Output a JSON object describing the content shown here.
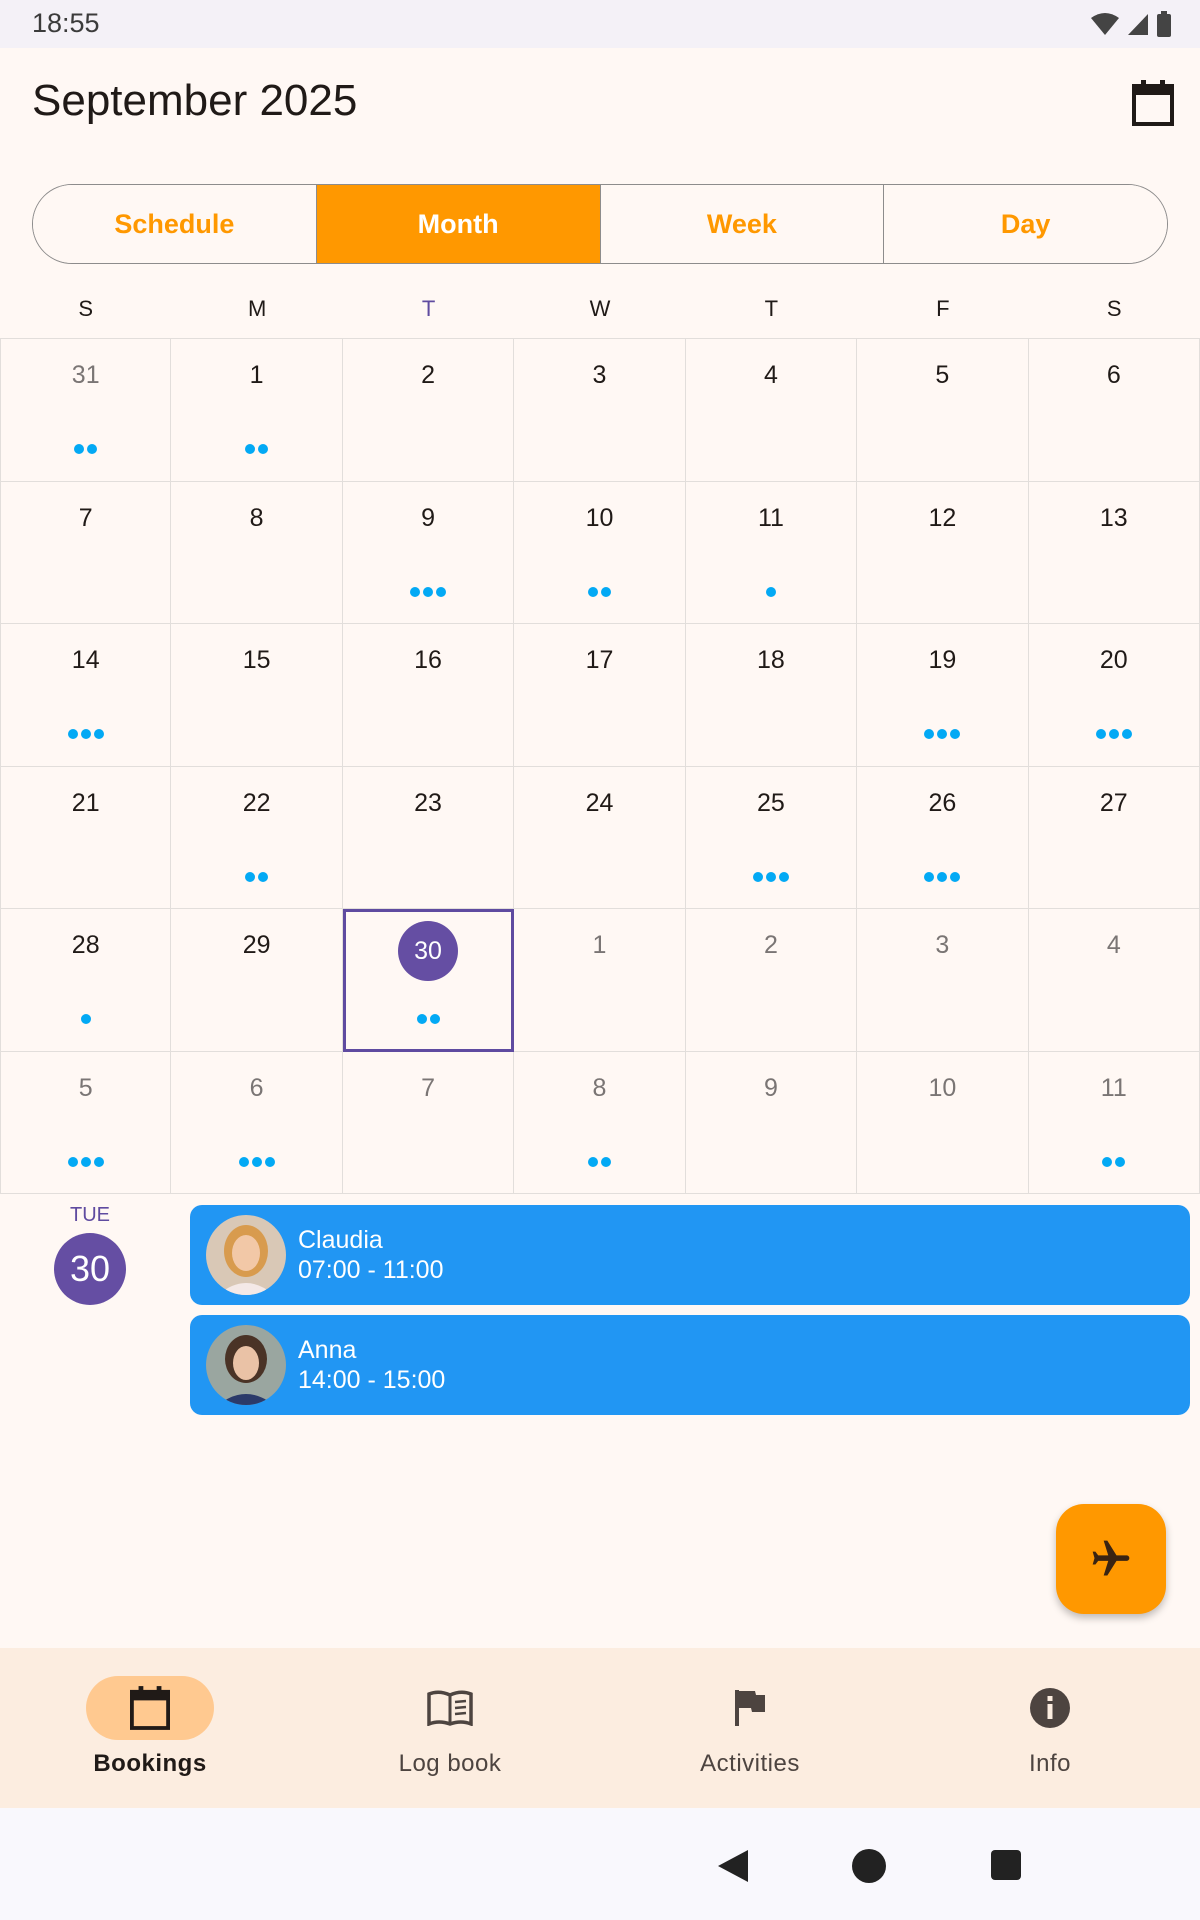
{
  "status_bar": {
    "time": "18:55"
  },
  "header": {
    "title": "September 2025"
  },
  "view_tabs": [
    {
      "label": "Schedule",
      "active": false
    },
    {
      "label": "Month",
      "active": true
    },
    {
      "label": "Week",
      "active": false
    },
    {
      "label": "Day",
      "active": false
    }
  ],
  "weekdays": [
    "S",
    "M",
    "T",
    "W",
    "T",
    "F",
    "S"
  ],
  "calendar": {
    "cells": [
      {
        "day": "31",
        "dots": 2,
        "muted": true
      },
      {
        "day": "1",
        "dots": 2
      },
      {
        "day": "2",
        "dots": 0
      },
      {
        "day": "3",
        "dots": 0
      },
      {
        "day": "4",
        "dots": 0
      },
      {
        "day": "5",
        "dots": 0
      },
      {
        "day": "6",
        "dots": 0
      },
      {
        "day": "7",
        "dots": 0
      },
      {
        "day": "8",
        "dots": 0
      },
      {
        "day": "9",
        "dots": 3
      },
      {
        "day": "10",
        "dots": 2
      },
      {
        "day": "11",
        "dots": 1
      },
      {
        "day": "12",
        "dots": 0
      },
      {
        "day": "13",
        "dots": 0
      },
      {
        "day": "14",
        "dots": 3
      },
      {
        "day": "15",
        "dots": 0
      },
      {
        "day": "16",
        "dots": 0
      },
      {
        "day": "17",
        "dots": 0
      },
      {
        "day": "18",
        "dots": 0
      },
      {
        "day": "19",
        "dots": 3
      },
      {
        "day": "20",
        "dots": 3
      },
      {
        "day": "21",
        "dots": 0
      },
      {
        "day": "22",
        "dots": 2
      },
      {
        "day": "23",
        "dots": 0
      },
      {
        "day": "24",
        "dots": 0
      },
      {
        "day": "25",
        "dots": 3
      },
      {
        "day": "26",
        "dots": 3
      },
      {
        "day": "27",
        "dots": 0
      },
      {
        "day": "28",
        "dots": 1
      },
      {
        "day": "29",
        "dots": 0
      },
      {
        "day": "30",
        "dots": 2,
        "selected": true
      },
      {
        "day": "1",
        "dots": 0,
        "muted": true
      },
      {
        "day": "2",
        "dots": 0,
        "muted": true
      },
      {
        "day": "3",
        "dots": 0,
        "muted": true
      },
      {
        "day": "4",
        "dots": 0,
        "muted": true
      },
      {
        "day": "5",
        "dots": 3,
        "muted": true
      },
      {
        "day": "6",
        "dots": 3,
        "muted": true
      },
      {
        "day": "7",
        "dots": 0,
        "muted": true
      },
      {
        "day": "8",
        "dots": 2,
        "muted": true
      },
      {
        "day": "9",
        "dots": 0,
        "muted": true
      },
      {
        "day": "10",
        "dots": 0,
        "muted": true
      },
      {
        "day": "11",
        "dots": 2,
        "muted": true
      }
    ]
  },
  "agenda": {
    "weekday": "TUE",
    "day": "30",
    "events": [
      {
        "name": "Claudia",
        "time": "07:00 - 11:00"
      },
      {
        "name": "Anna",
        "time": "14:00 - 15:00"
      }
    ]
  },
  "fab": {
    "icon": "airplane-icon"
  },
  "bottom_nav": [
    {
      "label": "Bookings",
      "icon": "calendar-icon",
      "active": true
    },
    {
      "label": "Log book",
      "icon": "book-icon",
      "active": false
    },
    {
      "label": "Activities",
      "icon": "flag-icon",
      "active": false
    },
    {
      "label": "Info",
      "icon": "info-icon",
      "active": false
    }
  ],
  "colors": {
    "accent": "#FF9800",
    "event": "#2196F3",
    "dot": "#03A9F4",
    "today": "#654EA3"
  }
}
